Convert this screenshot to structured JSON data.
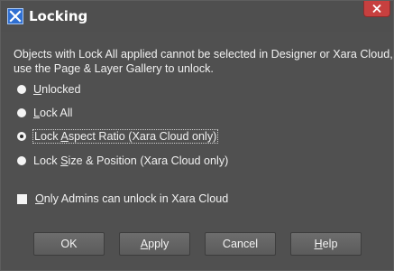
{
  "window": {
    "title": "Locking",
    "app_icon": "xara-x-icon",
    "close_icon": "close-icon",
    "colors": {
      "titlebar": "#4f4f4f",
      "body": "#505050",
      "close": "#c7403f",
      "app_icon": "#2f6fd2"
    }
  },
  "description": {
    "line1": "Objects with Lock All applied cannot be selected in Designer or Xara Cloud, so",
    "line2": "use the Page & Layer Gallery to unlock."
  },
  "options": [
    {
      "pre": "",
      "ul": "U",
      "post": "nlocked",
      "selected": false
    },
    {
      "pre": "",
      "ul": "L",
      "post": "ock All",
      "selected": false
    },
    {
      "pre": "Lock ",
      "ul": "A",
      "post": "spect Ratio (Xara Cloud only)",
      "selected": true
    },
    {
      "pre": "Lock ",
      "ul": "S",
      "post": "ize & Position (Xara Cloud only)",
      "selected": false
    }
  ],
  "checkbox": {
    "pre": "",
    "ul": "O",
    "post": "nly Admins can unlock in Xara Cloud",
    "checked": false
  },
  "buttons": {
    "ok": {
      "pre": "OK",
      "ul": "",
      "post": ""
    },
    "apply": {
      "pre": "",
      "ul": "A",
      "post": "pply"
    },
    "cancel": {
      "pre": "Cancel",
      "ul": "",
      "post": ""
    },
    "help": {
      "pre": "",
      "ul": "H",
      "post": "elp"
    }
  }
}
